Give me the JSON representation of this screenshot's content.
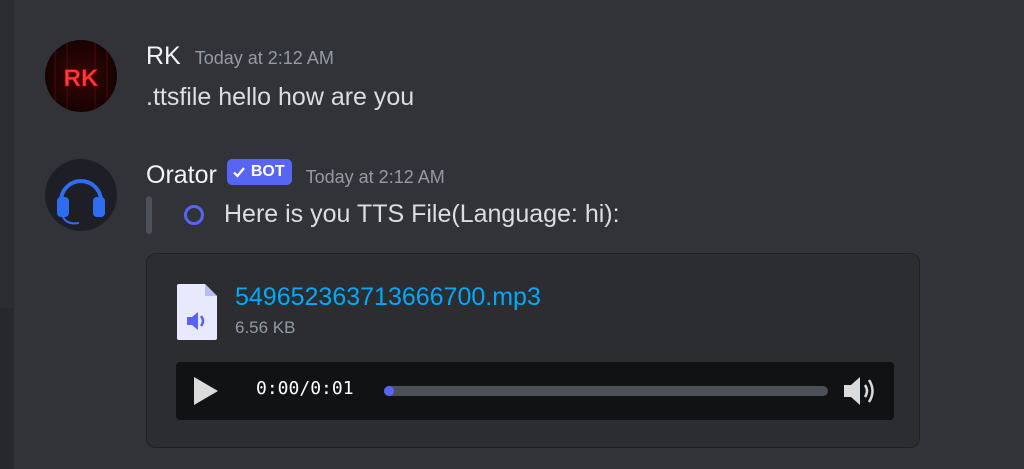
{
  "messages": [
    {
      "username": "RK",
      "timestamp": "Today at 2:12 AM",
      "avatar_text": "RK",
      "content": ".ttsfile hello how are you"
    },
    {
      "username": "Orator",
      "bot_tag": "BOT",
      "timestamp": "Today at 2:12 AM",
      "embed_text": "Here is you TTS File(Language: hi):",
      "attachment": {
        "file_name": "549652363713666700.mp3",
        "file_size": "6.56 KB",
        "player": {
          "current_time": "0:00",
          "separator": "/",
          "duration": "0:01",
          "progress": 0.02
        }
      }
    }
  ],
  "colors": {
    "background": "#313338",
    "blurple": "#5865f2",
    "link": "#00a8fc",
    "muted": "#949ba4"
  },
  "icons": {
    "rk_avatar": "rk-avatar-icon",
    "orator_avatar": "headphones-icon",
    "verified": "check-icon",
    "embed_marker": "circle-icon",
    "file": "audio-file-icon",
    "play": "play-icon",
    "volume": "volume-icon"
  }
}
